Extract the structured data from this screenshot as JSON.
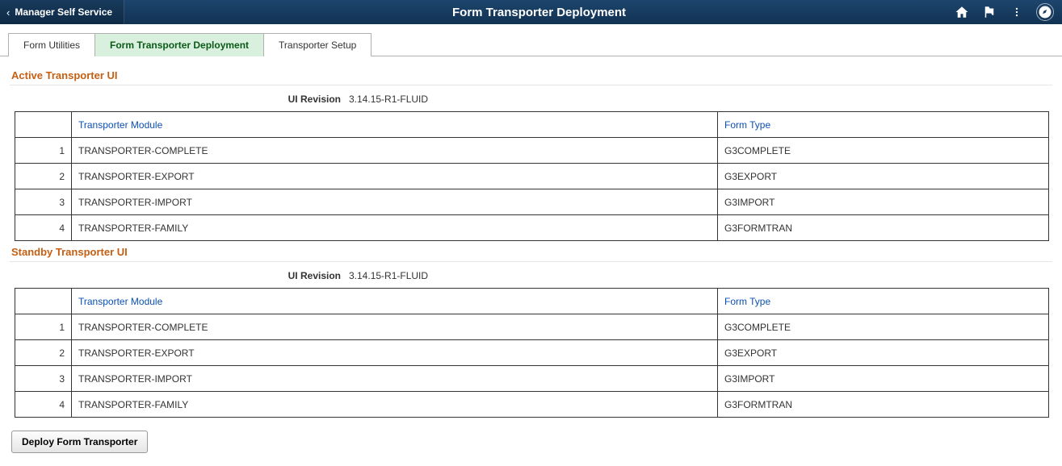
{
  "header": {
    "breadcrumb_label": "Manager Self Service",
    "page_title": "Form Transporter Deployment"
  },
  "tabs": [
    {
      "label": "Form Utilities",
      "active": false
    },
    {
      "label": "Form Transporter Deployment",
      "active": true
    },
    {
      "label": "Transporter Setup",
      "active": false
    }
  ],
  "sections": {
    "active": {
      "title": "Active Transporter UI",
      "revision_label": "UI Revision",
      "revision_value": "3.14.15-R1-FLUID",
      "columns": {
        "module": "Transporter Module",
        "form_type": "Form Type"
      },
      "rows": [
        {
          "n": "1",
          "module": "TRANSPORTER-COMPLETE",
          "form_type": "G3COMPLETE"
        },
        {
          "n": "2",
          "module": "TRANSPORTER-EXPORT",
          "form_type": "G3EXPORT"
        },
        {
          "n": "3",
          "module": "TRANSPORTER-IMPORT",
          "form_type": "G3IMPORT"
        },
        {
          "n": "4",
          "module": "TRANSPORTER-FAMILY",
          "form_type": "G3FORMTRAN"
        }
      ]
    },
    "standby": {
      "title": "Standby Transporter UI",
      "revision_label": "UI Revision",
      "revision_value": "3.14.15-R1-FLUID",
      "columns": {
        "module": "Transporter Module",
        "form_type": "Form Type"
      },
      "rows": [
        {
          "n": "1",
          "module": "TRANSPORTER-COMPLETE",
          "form_type": "G3COMPLETE"
        },
        {
          "n": "2",
          "module": "TRANSPORTER-EXPORT",
          "form_type": "G3EXPORT"
        },
        {
          "n": "3",
          "module": "TRANSPORTER-IMPORT",
          "form_type": "G3IMPORT"
        },
        {
          "n": "4",
          "module": "TRANSPORTER-FAMILY",
          "form_type": "G3FORMTRAN"
        }
      ]
    }
  },
  "buttons": {
    "deploy_label": "Deploy Form Transporter"
  }
}
